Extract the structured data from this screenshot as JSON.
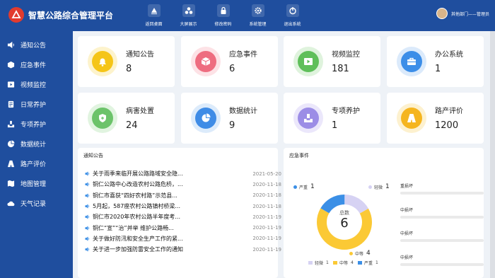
{
  "header": {
    "title": "智慧公路综合管理平台",
    "nav": [
      {
        "label": "返回桌面",
        "icon": "desktop-icon"
      },
      {
        "label": "大屏展示",
        "icon": "grid-icon"
      },
      {
        "label": "修改密码",
        "icon": "lock-icon"
      },
      {
        "label": "系统管理",
        "icon": "gear-icon"
      },
      {
        "label": "退出系统",
        "icon": "power-icon"
      }
    ],
    "user": "其他部门——管理员"
  },
  "sidebar": {
    "items": [
      {
        "label": "通知公告",
        "icon": "speaker-icon"
      },
      {
        "label": "应急事件",
        "icon": "cube-icon"
      },
      {
        "label": "视频监控",
        "icon": "video-icon"
      },
      {
        "label": "日常养护",
        "icon": "document-icon"
      },
      {
        "label": "专项养护",
        "icon": "tray-icon"
      },
      {
        "label": "数据统计",
        "icon": "pie-icon"
      },
      {
        "label": "路产评价",
        "icon": "road-icon"
      },
      {
        "label": "地图管理",
        "icon": "map-icon"
      },
      {
        "label": "天气记录",
        "icon": "cloud-icon"
      }
    ]
  },
  "cards": [
    {
      "title": "通知公告",
      "value": "8",
      "icon": "bell-icon",
      "color": "#f5c518",
      "bg": "#fdf3cc"
    },
    {
      "title": "应急事件",
      "value": "6",
      "icon": "box-icon",
      "color": "#ee6d80",
      "bg": "#fde2e6"
    },
    {
      "title": "视频监控",
      "value": "181",
      "icon": "video-icon",
      "color": "#5fbf5a",
      "bg": "#dff3dd"
    },
    {
      "title": "办公系统",
      "value": "1",
      "icon": "briefcase-icon",
      "color": "#3c8ee8",
      "bg": "#dbeafb"
    },
    {
      "title": "病害处置",
      "value": "24",
      "icon": "shield-icon",
      "color": "#6cc36a",
      "bg": "#e1f4e0"
    },
    {
      "title": "数据统计",
      "value": "9",
      "icon": "pie-icon",
      "color": "#3f8ce6",
      "bg": "#dcebfb"
    },
    {
      "title": "专项养护",
      "value": "1",
      "icon": "tray-icon",
      "color": "#9c8de6",
      "bg": "#ebe7fb"
    },
    {
      "title": "路产评价",
      "value": "1200",
      "icon": "road-icon",
      "color": "#f5b51f",
      "bg": "#fdf1cf"
    }
  ],
  "notice_panel": {
    "title": "通知公告",
    "items": [
      {
        "text": "关于雨季来临开展公路路域安全隐...",
        "date": "2021-05-20"
      },
      {
        "text": "铜仁公路中心改造农村公路危桥，...",
        "date": "2020-11-18"
      },
      {
        "text": "铜仁市喜获“四好农村路”示范县...",
        "date": "2020-11-18"
      },
      {
        "text": "5月起，587座农村公路镇村桥梁...",
        "date": "2020-11-18"
      },
      {
        "text": "铜仁市2020年农村公路半年度考...",
        "date": "2020-11-19"
      },
      {
        "text": "铜仁“宣”“治”并举 维护公路畅...",
        "date": "2020-11-19"
      },
      {
        "text": "关于做好防汛和安全生产工作的紧...",
        "date": "2020-11-19"
      },
      {
        "text": "关于进一步加强防雷安全工作的通知",
        "date": "2020-11-19"
      }
    ]
  },
  "emergency_panel": {
    "title": "应急事件",
    "center_label": "总数",
    "center_value": "6",
    "side_labels": [
      "重损坏",
      "中损坏",
      "中损坏",
      "中损坏"
    ]
  },
  "chart_data": {
    "type": "pie",
    "categories": [
      "轻微",
      "中等",
      "严重"
    ],
    "values": [
      1,
      4,
      1
    ],
    "colors": [
      "#d6d2f3",
      "#fbc935",
      "#3b8fe6"
    ],
    "total": 6
  }
}
